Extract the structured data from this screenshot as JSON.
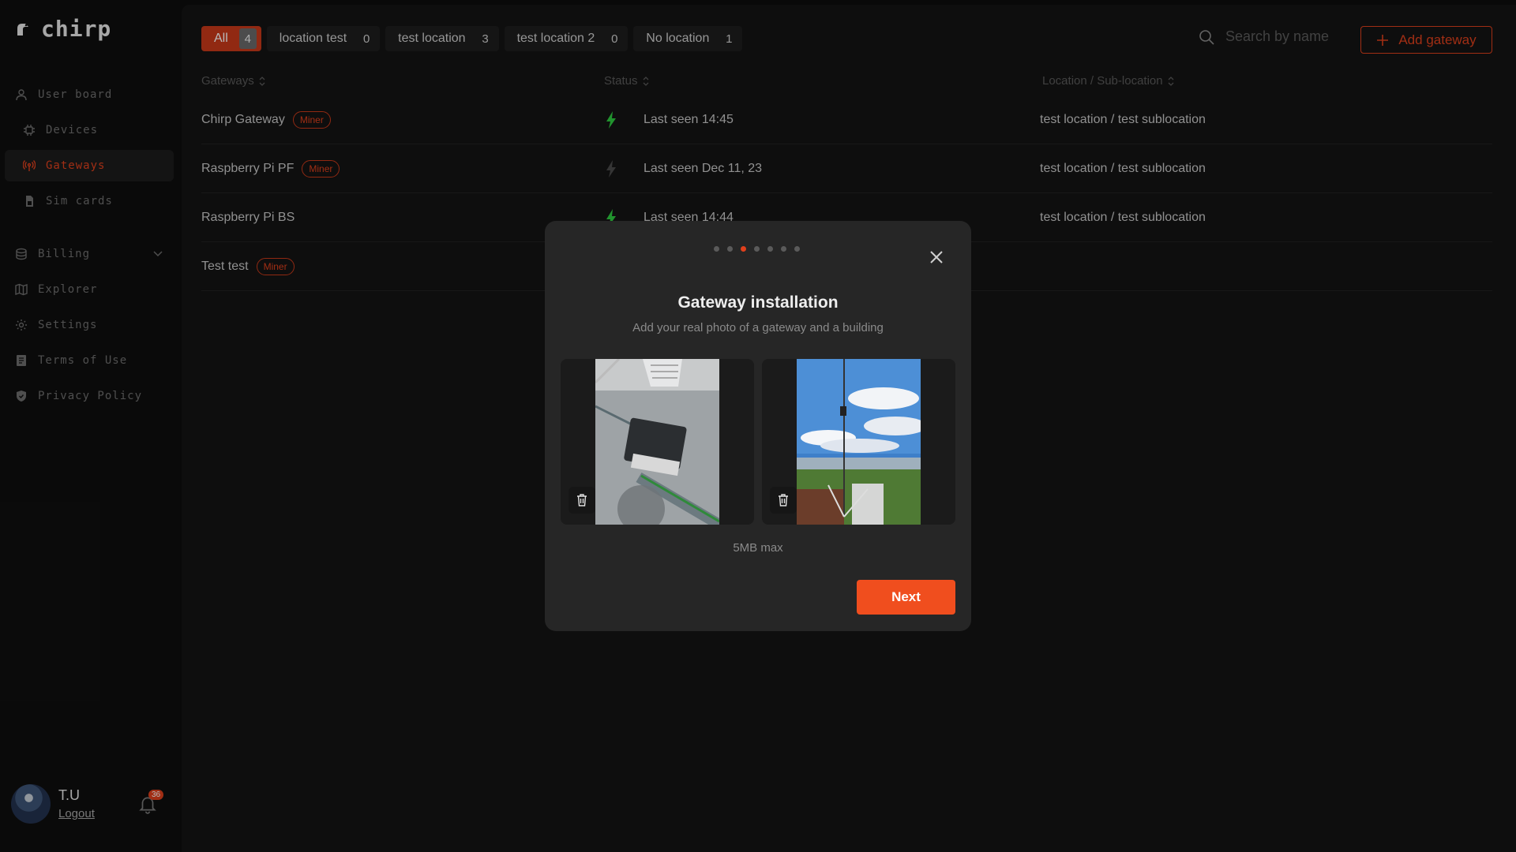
{
  "app": {
    "logo_text": "chirp",
    "accent": "#e0401c"
  },
  "sidebar": {
    "items": [
      {
        "label": "User board",
        "icon": "user-icon"
      },
      {
        "label": "Devices",
        "icon": "chip-icon"
      },
      {
        "label": "Gateways",
        "icon": "antenna-icon",
        "active": true
      },
      {
        "label": "Sim cards",
        "icon": "sim-card-icon"
      },
      {
        "label": "Billing",
        "icon": "billing-icon"
      },
      {
        "label": "Explorer",
        "icon": "map-icon"
      },
      {
        "label": "Settings",
        "icon": "gear-icon"
      },
      {
        "label": "Terms of Use",
        "icon": "document-icon"
      },
      {
        "label": "Privacy Policy",
        "icon": "shield-icon"
      }
    ]
  },
  "user": {
    "name": "T.U",
    "logout_label": "Logout",
    "notifications": "36"
  },
  "filters": [
    {
      "label": "All",
      "count": "4",
      "active": true
    },
    {
      "label": "location test",
      "count": "0"
    },
    {
      "label": "test location",
      "count": "3"
    },
    {
      "label": "test location 2",
      "count": "0"
    },
    {
      "label": "No location",
      "count": "1"
    }
  ],
  "search": {
    "placeholder": "Search by name"
  },
  "add_gateway_label": "Add gateway",
  "table": {
    "columns": [
      "Gateways",
      "Status",
      "Location / Sub-location"
    ],
    "rows": [
      {
        "name": "Chirp Gateway",
        "badge": "Miner",
        "status": "Last seen 14:45",
        "online": true,
        "location": "test location / test sublocation"
      },
      {
        "name": "Raspberry Pi PF",
        "badge": "Miner",
        "status": "Last seen Dec 11, 23",
        "online": false,
        "location": "test location / test sublocation"
      },
      {
        "name": "Raspberry Pi BS",
        "badge": "",
        "status": "Last seen 14:44",
        "online": true,
        "location": "test location / test sublocation"
      },
      {
        "name": "Test test",
        "badge": "Miner",
        "status": "",
        "online": false,
        "location": ""
      }
    ]
  },
  "modal": {
    "title": "Gateway installation",
    "subtitle": "Add your real photo of a gateway and a building",
    "steps_total": 7,
    "current_step": 3,
    "photos": [
      {
        "icon": "gateway-photo"
      },
      {
        "icon": "building-photo"
      }
    ],
    "limit_text": "5MB max",
    "next_label": "Next"
  }
}
